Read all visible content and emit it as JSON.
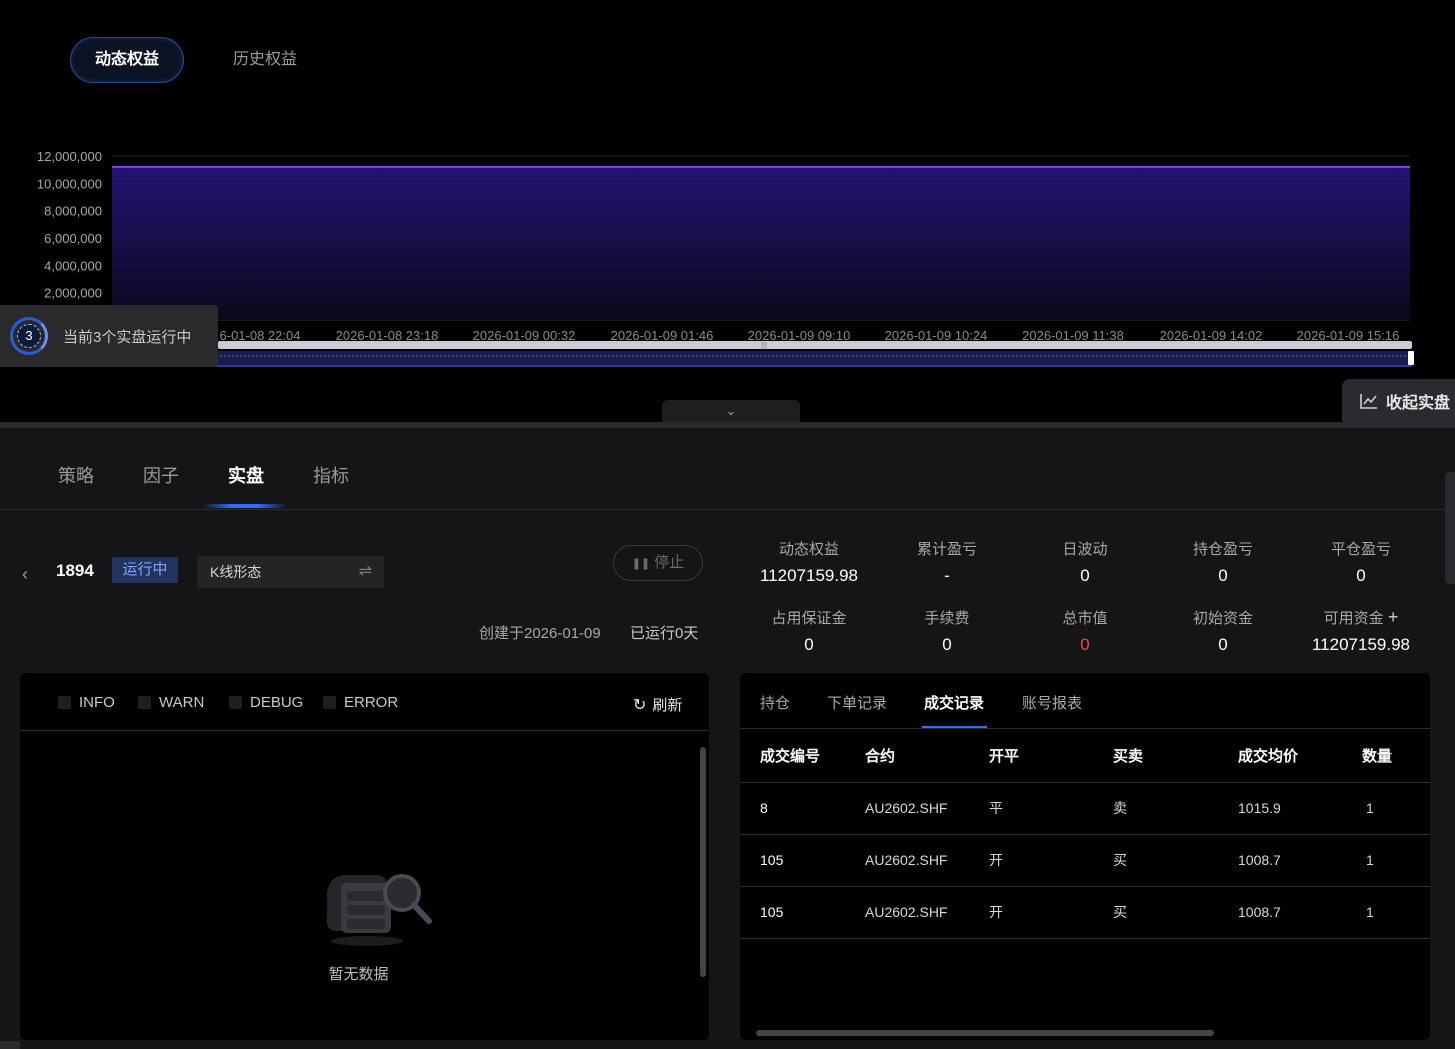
{
  "equity_tabs": [
    "动态权益",
    "历史权益"
  ],
  "chart_data": {
    "type": "area",
    "title": "",
    "yticks": [
      "12,000,000",
      "10,000,000",
      "8,000,000",
      "6,000,000",
      "4,000,000",
      "2,000,000"
    ],
    "ylim": [
      0,
      12000000
    ],
    "x": [
      "6-01-08 22:04",
      "2026-01-08 23:18",
      "2026-01-09 00:32",
      "2026-01-09 01:46",
      "2026-01-09 09:10",
      "2026-01-09 10:24",
      "2026-01-09 11:38",
      "2026-01-09 14:02",
      "2026-01-09 15:16"
    ],
    "series": [
      {
        "values": [
          11207159.98,
          11207159.98,
          11207159.98,
          11207159.98,
          11207159.98,
          11207159.98,
          11207159.98,
          11207159.98,
          11207159.98
        ]
      }
    ],
    "colors": {
      "line": "#8a3df0",
      "fill": "#1a1050"
    },
    "grid": true,
    "zoom_slider": true
  },
  "running_notice": {
    "count": "3",
    "text": "当前3个实盘运行中"
  },
  "fold_live_label": "收起实盘",
  "main_tabs": [
    "策略",
    "因子",
    "实盘",
    "指标"
  ],
  "live": {
    "id": "1894",
    "status": "运行中",
    "strategy": "K线形态",
    "stop_label": "停止",
    "created_at": "创建于2026-01-09",
    "run_days": "已运行0天"
  },
  "stats": [
    {
      "label": "动态权益",
      "value": "11207159.98"
    },
    {
      "label": "累计盈亏",
      "value": "-"
    },
    {
      "label": "日波动",
      "value": "0"
    },
    {
      "label": "持仓盈亏",
      "value": "0"
    },
    {
      "label": "平仓盈亏",
      "value": "0"
    },
    {
      "label": "占用保证金",
      "value": "0"
    },
    {
      "label": "手续费",
      "value": "0"
    },
    {
      "label": "总市值",
      "value": "0"
    },
    {
      "label": "初始资金",
      "value": "0"
    },
    {
      "label": "可用资金",
      "value": "11207159.98"
    }
  ],
  "log": {
    "levels": [
      "INFO",
      "WARN",
      "DEBUG",
      "ERROR"
    ],
    "refresh_label": "刷新",
    "empty_text": "暂无数据"
  },
  "records": {
    "tabs": [
      "持仓",
      "下单记录",
      "成交记录",
      "账号报表"
    ],
    "columns": [
      "成交编号",
      "合约",
      "开平",
      "买卖",
      "成交均价",
      "数量"
    ],
    "rows": [
      [
        "8",
        "AU2602.SHF",
        "平",
        "卖",
        "1015.9",
        "1"
      ],
      [
        "105",
        "AU2602.SHF",
        "开",
        "买",
        "1008.7",
        "1"
      ],
      [
        "105",
        "AU2602.SHF",
        "开",
        "买",
        "1008.7",
        "1"
      ]
    ]
  },
  "colors": {
    "accent": "#2f6eff",
    "badge_bg": "#22335f",
    "negative": "#e84a4a"
  }
}
